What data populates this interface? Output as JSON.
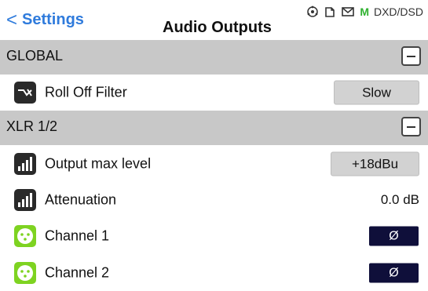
{
  "header": {
    "back_label": "Settings",
    "title": "Audio Outputs",
    "status": {
      "m_label": "M",
      "format_label": "DXD/DSD"
    }
  },
  "sections": [
    {
      "label": "GLOBAL"
    },
    {
      "label": "XLR 1/2"
    }
  ],
  "rows": {
    "roll_off": {
      "label": "Roll Off Filter",
      "value": "Slow"
    },
    "output_max": {
      "label": "Output max level",
      "value": "+18dBu"
    },
    "attenuation": {
      "label": "Attenuation",
      "value": "0.0 dB"
    },
    "channel1": {
      "label": "Channel 1",
      "phase_label": "Ø"
    },
    "channel2": {
      "label": "Channel 2",
      "phase_label": "Ø"
    }
  },
  "colors": {
    "accent": "#2f7bdc",
    "section_bg": "#c8c8c8",
    "phase_button": "#0f0f3a",
    "channel_icon": "#7ed321"
  }
}
